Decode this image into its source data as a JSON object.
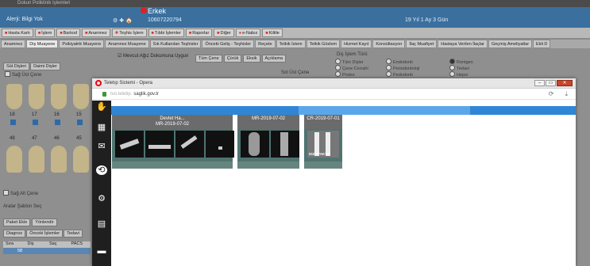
{
  "app": {
    "title": "Dokun Poliklinik Işlemleri",
    "allergy_label": "Alerji: Bilgi Yok",
    "gender": "Erkek",
    "tc_icons": "⚙ ✚ 🏠",
    "tc_no": "10607220794",
    "age": "19 Yıl 1 Ay 3 Gün"
  },
  "toolbar": [
    "Hasta Kartı",
    "İşlem",
    "Barkod",
    "Anamnez",
    "Teşhis İşlem",
    "Tıbbi İşlemler",
    "Raporlar",
    "Diğer",
    "e-Nabız",
    "Kilitle"
  ],
  "tabs": [
    "Anamnez",
    "Diş Muayene",
    "Psikiyatrik Muayene",
    "Anamnez Muayene",
    "Sık Kullanılan Teşhisler",
    "Önceki Geliş - Teşhisler",
    "Reçete",
    "Tetkik İstem",
    "Tetkik Gözlem",
    "Hizmet Kayıt",
    "Konsültasyon",
    "İlaç Muafiyet",
    "Hastaya Verilen İlaçlar",
    "Geçmiş Ameliyatlar",
    "Ekli D"
  ],
  "bg": {
    "subtabs": [
      "Süt Dişleri",
      "Daimi Dişler"
    ],
    "sag_ust": "Sağ Üst Çene",
    "sag_alt": "Sağ Alt Çene",
    "mid_checkbox": "☑ Mevcut Ağız Dokumuna Uygun",
    "mid_buttons": [
      "Tüm Çene",
      "Çürük",
      "Eksik",
      "Açıklama"
    ],
    "sol_ust": "Sol Üst Çene",
    "tooth_numbers_top": [
      "18",
      "17",
      "16",
      "15"
    ],
    "tooth_numbers_bottom": [
      "48",
      "47",
      "46",
      "45"
    ],
    "radio_title": "Diş İşlem Türü",
    "radios": [
      {
        "label": "Tüm Dişler",
        "sel": false
      },
      {
        "label": "Çene Cerrahi",
        "sel": false
      },
      {
        "label": "Protez",
        "sel": false
      },
      {
        "label": "Endodonti",
        "sel": false
      },
      {
        "label": "Periodontoloji",
        "sel": false
      },
      {
        "label": "Pedodonti",
        "sel": false
      },
      {
        "label": "Rontgen",
        "sel": true
      },
      {
        "label": "Tedavi",
        "sel": false
      },
      {
        "label": "Hepsi",
        "sel": false
      }
    ],
    "arac_label": "Aralar Şablon Seç",
    "left_buttons": [
      "Paket Ekle",
      "Yönlendir"
    ],
    "left_tabs": [
      "Diagnoz",
      "Önceki İşlemler",
      "Tedavi"
    ],
    "grid_headers": [
      "Sıra",
      "Diş",
      "Saç",
      "PACS"
    ],
    "grid_row_value": "58"
  },
  "popup": {
    "title": "Teletıp Sistemi - Opera",
    "addr_faded": "tvo.teletip.",
    "addr_main": "saglik.gov.tr",
    "addr_icons": [
      "⟳",
      "⤓"
    ],
    "cards": [
      {
        "header_line1": "Devlet Ha...",
        "header_line2": "MR-2019-07-02",
        "count": 4,
        "label": ""
      },
      {
        "header_line1": "",
        "header_line2": "MR-2019-07-02",
        "count": 2,
        "label": ""
      },
      {
        "header_line1": "",
        "header_line2": "CR-2019-07-01",
        "count": 1,
        "label": "DIZ AYAKTA"
      }
    ]
  }
}
